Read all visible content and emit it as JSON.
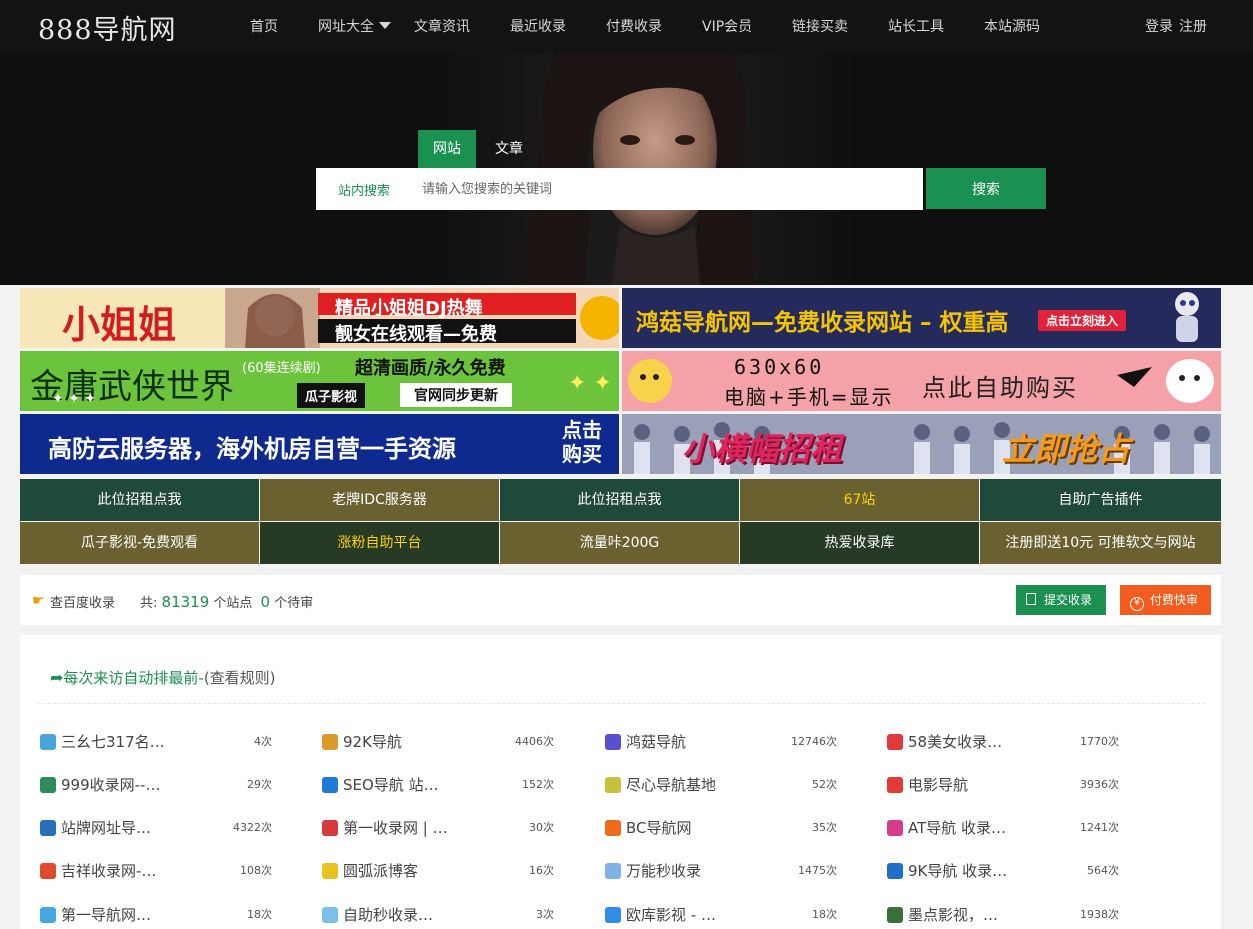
{
  "header": {
    "logo": "888导航网",
    "nav": [
      {
        "label": "首页",
        "name": "nav-home"
      },
      {
        "label": "网址大全",
        "name": "nav-directory"
      },
      {
        "label": "文章资讯",
        "name": "nav-articles"
      },
      {
        "label": "最近收录",
        "name": "nav-recent"
      },
      {
        "label": "付费收录",
        "name": "nav-paid"
      },
      {
        "label": "VIP会员",
        "name": "nav-vip"
      },
      {
        "label": "链接买卖",
        "name": "nav-links"
      },
      {
        "label": "站长工具",
        "name": "nav-tools"
      },
      {
        "label": "本站源码",
        "name": "nav-source"
      }
    ],
    "login": "登录",
    "register": "注册"
  },
  "search": {
    "tabs": [
      "网站",
      "文章"
    ],
    "label": "站内搜索",
    "placeholder": "请输入您搜索的关键词",
    "button": "搜索"
  },
  "banners": [
    {
      "main": "小姐姐",
      "sub1": "精品小姐姐DJ热舞",
      "sub2": "靓女在线观看—免费"
    },
    {
      "main": "鸿菇导航网—免费收录网站 – 权重高",
      "cta": "点击立刻进入"
    },
    {
      "main": "金庸武侠世界",
      "tag": "(60集连续剧)",
      "sub1": "超清画质/永久免费",
      "brand": "瓜子影视",
      "sub2": "官网同步更新"
    },
    {
      "main": "630x60",
      "sub1": "电脑+手机=显示",
      "sub2": "点此自助购买"
    },
    {
      "main": "高防云服务器，海外机房自营一手资源",
      "cta": "点击购买"
    },
    {
      "main": "小横幅招租",
      "cta": "立即抢占"
    }
  ],
  "ad_grid": [
    {
      "label": "此位招租点我",
      "bg": "#1f4a39",
      "color": "#ffffff"
    },
    {
      "label": "老牌IDC服务器",
      "bg": "#6b6130",
      "color": "#ffffff"
    },
    {
      "label": "此位招租点我",
      "bg": "#1f4a39",
      "color": "#ffffff"
    },
    {
      "label": "67站",
      "bg": "#6b6130",
      "color": "#ffd400"
    },
    {
      "label": "自助广告插件",
      "bg": "#1f4a39",
      "color": "#ffffff"
    },
    {
      "label": "瓜子影视-免费观看",
      "bg": "#6b6130",
      "color": "#ffffff"
    },
    {
      "label": "涨粉自助平台",
      "bg": "#263a26",
      "color": "#ffd400"
    },
    {
      "label": "流量咔200G",
      "bg": "#6b6130",
      "color": "#ffffff"
    },
    {
      "label": "热爱收录库",
      "bg": "#263a26",
      "color": "#ffffff"
    },
    {
      "label": "注册即送10元 可推软文与网站",
      "bg": "#6b6130",
      "color": "#ffffff"
    }
  ],
  "stats": {
    "baidu": "查百度收录",
    "total_prefix": "共:",
    "total": "81319",
    "total_suffix": "个站点",
    "pending": "0",
    "pending_suffix": "个待审",
    "submit": "提交收录",
    "paid": "付费快审"
  },
  "panel": {
    "title": "每次来访自动排最前-",
    "rule": "(查看规则)"
  },
  "sites": [
    {
      "name": "三幺七317名…",
      "count": "4次",
      "icon": "search-icon",
      "color": "#4aa3df"
    },
    {
      "name": "92K导航",
      "count": "4406次",
      "icon": "diamond-icon",
      "color": "#d89a2b"
    },
    {
      "name": "鸿菇导航",
      "count": "12746次",
      "icon": "star-burst-icon",
      "color": "#5a4fcf"
    },
    {
      "name": "58美女收录…",
      "count": "1770次",
      "icon": "star-icon",
      "color": "#e03a3a"
    },
    {
      "name": "999收录网--…",
      "count": "29次",
      "icon": "chart-icon",
      "color": "#2e8b57"
    },
    {
      "name": "SEO导航  站…",
      "count": "152次",
      "icon": "s-icon",
      "color": "#1e7ad6"
    },
    {
      "name": "尽心导航基地",
      "count": "52次",
      "icon": "gem-icon",
      "color": "#c8c23a"
    },
    {
      "name": "电影导航",
      "count": "3936次",
      "icon": "play-icon",
      "color": "#e53935"
    },
    {
      "name": "站牌网址导…",
      "count": "4322次",
      "icon": "cube-icon",
      "color": "#2a6fba"
    },
    {
      "name": "第一收录网 | …",
      "count": "30次",
      "icon": "one-icon",
      "color": "#d63a3a"
    },
    {
      "name": "BC导航网",
      "count": "35次",
      "icon": "swirl-icon",
      "color": "#f06a1e"
    },
    {
      "name": "AT导航  收录…",
      "count": "1241次",
      "icon": "shou-icon",
      "color": "#d63c8a"
    },
    {
      "name": "吉祥收录网-…",
      "count": "108次",
      "icon": "target-icon",
      "color": "#e04a2a"
    },
    {
      "name": "圆弧派博客",
      "count": "16次",
      "icon": "ring-icon",
      "color": "#e8c21e"
    },
    {
      "name": "万能秒收录",
      "count": "1475次",
      "icon": "wave-icon",
      "color": "#7fb0e6"
    },
    {
      "name": "9K导航  收录…",
      "count": "564次",
      "icon": "nine-k-icon",
      "color": "#1e6fc8"
    },
    {
      "name": "第一导航网…",
      "count": "18次",
      "icon": "gear-icon",
      "color": "#49a7e0"
    },
    {
      "name": "自助秒收录…",
      "count": "3次",
      "icon": "m-icon",
      "color": "#7ac0e8"
    },
    {
      "name": "欧库影视 - …",
      "count": "18次",
      "icon": "triangle-play-icon",
      "color": "#2f8de6"
    },
    {
      "name": "墨点影视，…",
      "count": "1938次",
      "icon": "hex-icon",
      "color": "#3a6f3a"
    }
  ]
}
